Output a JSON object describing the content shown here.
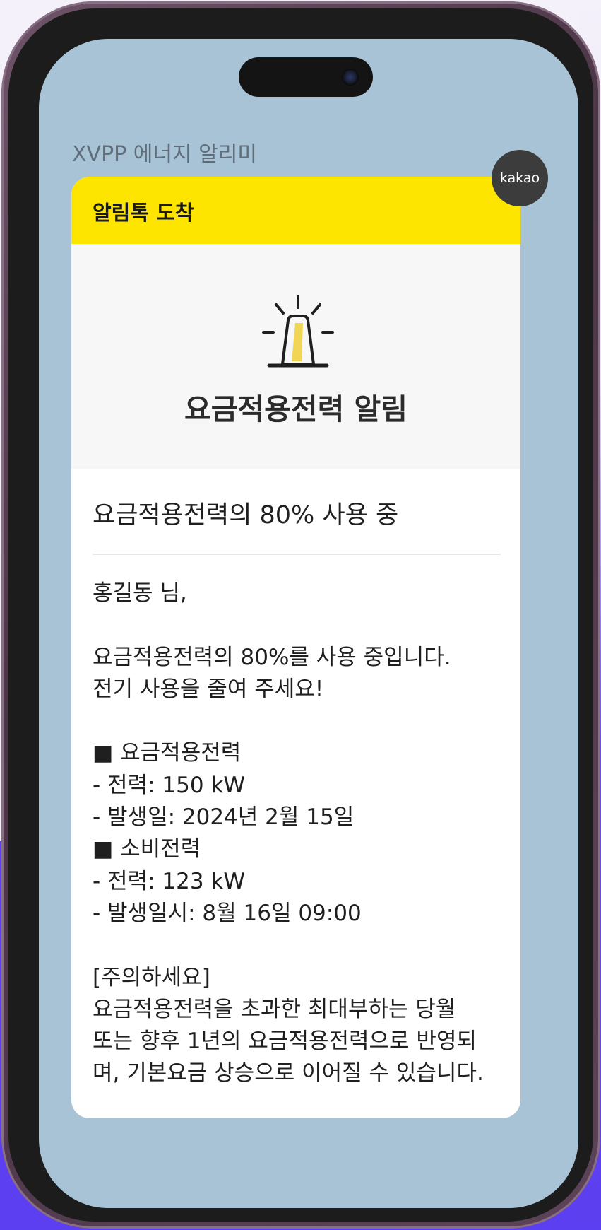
{
  "app": {
    "title": "XVPP 에너지 알리미",
    "badge": "kakao"
  },
  "card": {
    "header": "알림톡 도착",
    "icon": "siren-icon",
    "hero_title": "요금적용전력 알림",
    "subject": "요금적용전력의 80% 사용 중",
    "greeting": "홍길동 님,",
    "message_lines": [
      "요금적용전력의 80%를 사용 중입니다.",
      "전기 사용을 줄여 주세요!"
    ],
    "sections": [
      {
        "heading": "■ 요금적용전력",
        "items": [
          "- 전력: 150 kW",
          "- 발생일: 2024년 2월 15일"
        ]
      },
      {
        "heading": "■ 소비전력",
        "items": [
          "- 전력: 123 kW",
          "- 발생일시: 8월 16일 09:00"
        ]
      }
    ],
    "notice_title": "[주의하세요]",
    "notice_lines": [
      "요금적용전력을 초과한 최대부하는 당월",
      "또는 향후 1년의 요금적용전력으로 반영되",
      "며, 기본요금 상승으로 이어질 수 있습니다."
    ]
  },
  "colors": {
    "header_yellow": "#fee500",
    "screen_bg": "#a8c3d6",
    "siren_fill": "#f1d656",
    "badge_bg": "#3c3c3c"
  }
}
